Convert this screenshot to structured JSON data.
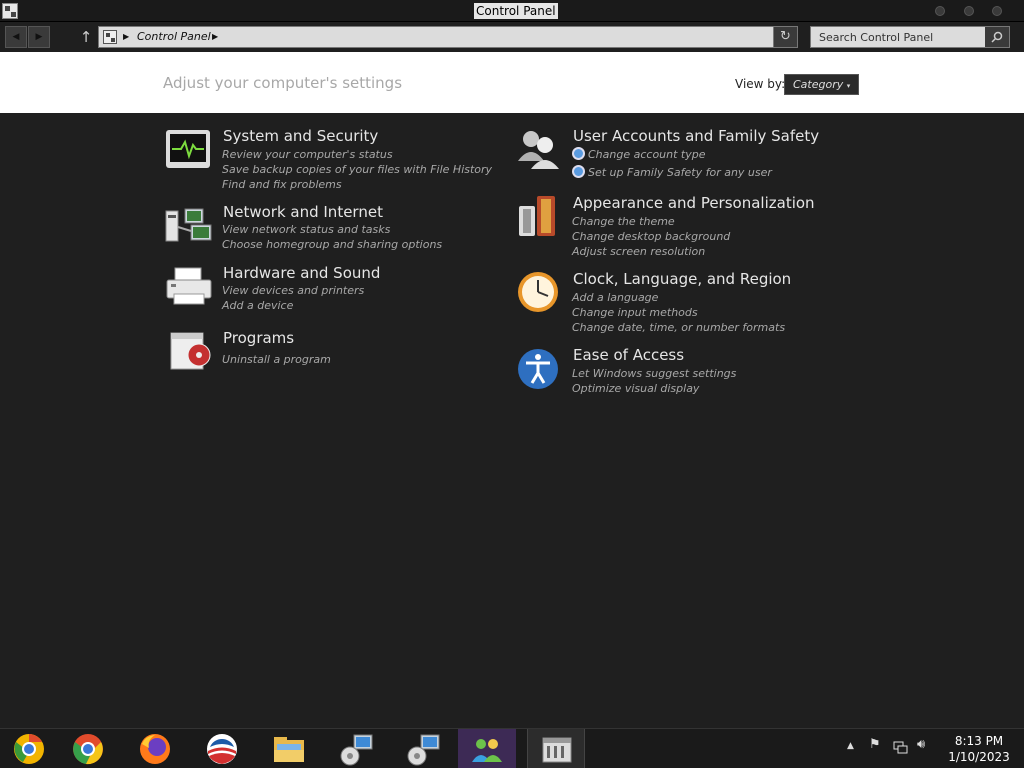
{
  "window": {
    "title": "Control Panel"
  },
  "address": {
    "path": "Control Panel"
  },
  "search": {
    "placeholder": "Search Control Panel"
  },
  "header": {
    "title": "Adjust your computer's settings",
    "view_by_label": "View by:",
    "view_by_value": "Category"
  },
  "categories": [
    {
      "title": "System and Security",
      "links": [
        "Review your computer's status",
        "Save backup copies of your files with File History",
        "Find and fix problems"
      ]
    },
    {
      "title": "Network and Internet",
      "links": [
        "View network status and tasks",
        "Choose homegroup and sharing options"
      ]
    },
    {
      "title": "Hardware and Sound",
      "links": [
        "View devices and printers",
        "Add a device"
      ]
    },
    {
      "title": "Programs",
      "links": [
        "Uninstall a program"
      ]
    },
    {
      "title": "User Accounts and Family Safety",
      "links": [
        "Change account type",
        "Set up Family Safety for any user"
      ]
    },
    {
      "title": "Appearance and Personalization",
      "links": [
        "Change the theme",
        "Change desktop background",
        "Adjust screen resolution"
      ]
    },
    {
      "title": "Clock, Language, and Region",
      "links": [
        "Add a language",
        "Change input methods",
        "Change date, time, or number formats"
      ]
    },
    {
      "title": "Ease of Access",
      "links": [
        "Let Windows suggest settings",
        "Optimize visual display"
      ]
    }
  ],
  "taskbar": {
    "items": [
      "chrome-canary-icon",
      "chrome-icon",
      "firefox-icon",
      "obama-campaign-icon",
      "file-explorer-icon",
      "network-setup-icon",
      "network-setup-icon",
      "people-icon",
      "control-panel-icon"
    ],
    "time": "8:13 PM",
    "date": "1/10/2023"
  },
  "colors": {
    "background": "#1f1f1f",
    "header_bg": "#ffffff",
    "title_text": "#e6e6e6",
    "link_text": "#a8a8a8",
    "active_task": "#3d2a55"
  }
}
